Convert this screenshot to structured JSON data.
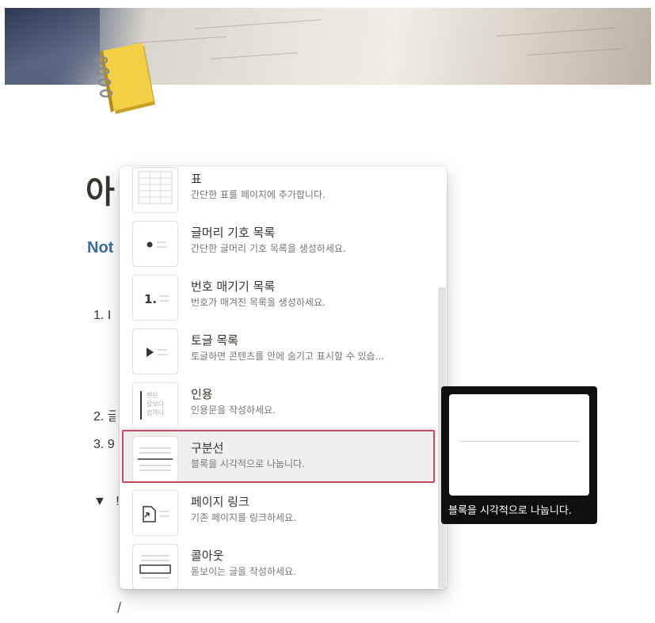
{
  "page": {
    "title": "아",
    "subtitle": "Not",
    "background_items": [
      {
        "number": "1.",
        "text": "I"
      },
      {
        "number": "2.",
        "text": "글"
      },
      {
        "number": "3.",
        "text": "9"
      },
      {
        "number": "▼",
        "text": "!"
      }
    ],
    "bottom_glyph": "/"
  },
  "icons": {
    "page_icon": "notebook-icon"
  },
  "menu": {
    "items": [
      {
        "title": "표",
        "desc": "간단한 표를 페이지에 추가합니다.",
        "icon": "table-icon"
      },
      {
        "title": "글머리 기호 목록",
        "desc": "간단한 글머리 기호 목록을 생성하세요.",
        "icon": "bulleted-list-icon"
      },
      {
        "title": "번호 매기기 목록",
        "desc": "번호가 매겨진 목록을 생성하세요.",
        "icon": "numbered-list-icon"
      },
      {
        "title": "토글 목록",
        "desc": "토글하면 콘텐츠를 안에 숨기고 표시할 수 있습...",
        "icon": "toggle-list-icon"
      },
      {
        "title": "인용",
        "desc": "인용문을 작성하세요.",
        "icon": "quote-icon",
        "thumb_text": [
          "펜은",
          "칼보다",
          "강하다"
        ]
      },
      {
        "title": "구분선",
        "desc": "블록을 시각적으로 나눕니다.",
        "icon": "divider-icon",
        "selected": true
      },
      {
        "title": "페이지 링크",
        "desc": "기존 페이지를 링크하세요.",
        "icon": "page-link-icon"
      },
      {
        "title": "콜아웃",
        "desc": "돋보이는 글을 작성하세요.",
        "icon": "callout-icon"
      }
    ]
  },
  "tooltip": {
    "caption": "블록을 시각적으로 나눕니다."
  },
  "colors": {
    "selection_border": "#c94b63",
    "subtitle": "#3a6b9c",
    "tooltip_bg": "#0f0f0f"
  }
}
